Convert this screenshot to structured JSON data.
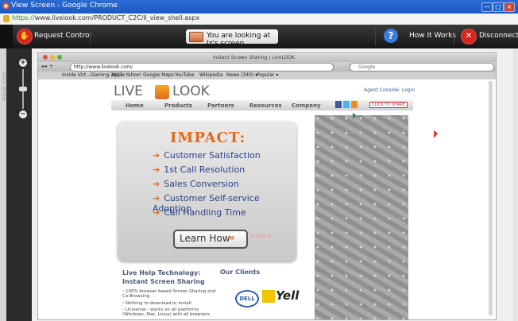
{
  "window": {
    "title": "View Screen - Google Chrome",
    "url_scheme": "https://",
    "url_rest": "www.livelook.com/PRODUCT_C2C/ll_view_shell.aspx",
    "min_label": "—",
    "max_label": "□",
    "close_label": "×"
  },
  "toolbar": {
    "request_control_label": "Request Control",
    "notice_text": "You are looking at Iz's screen",
    "how_it_works_label": "How It Works",
    "disconnect_label": "Disconnect",
    "request_icon_glyph": "✋",
    "help_icon_glyph": "?",
    "disconnect_icon_glyph": "✕"
  },
  "zoom_panel": {
    "label": "Adjust zoom",
    "plus": "+",
    "minus": "−"
  },
  "mac_window": {
    "title": "Instant Screen Sharing | LiveLOOK",
    "address": "http://www.livelook.com/",
    "search_placeholder": "Google",
    "bookmarks": [
      "Inside Virt...Gaming 2011",
      "Apple",
      "Yahoo!",
      "Google Maps",
      "YouTube",
      "Wikipedia",
      "News (340) ▾",
      "Popular ▾"
    ]
  },
  "site": {
    "logo_left": "LIVE",
    "logo_right": "LOOK",
    "top_links": [
      "Agent Console",
      "Login"
    ],
    "nav": [
      "Home",
      "Products",
      "Partners",
      "Resources",
      "Company"
    ],
    "click_to_share": "CLICK TO SHARE",
    "impact_title": "IMPACT:",
    "impact_items": [
      "Customer Satisfaction",
      "1st Call Resolution",
      "Sales Conversion",
      "Customer Self-service Adoption",
      "Call Handling Time"
    ],
    "learn_how": "Learn How",
    "footer_col1_title": "Live Help Technology:\nInstant Screen Sharing",
    "footer_col1_bullets": [
      "100% browser based Screen Sharing and Co-Browsing",
      "Nothing to download or install",
      "Universal - works on all platforms (Windows, Mac, Linux) with all browsers"
    ],
    "footer_col2_title": "Our Clients",
    "client_logos": [
      "DELL",
      "Yell"
    ]
  },
  "colors": {
    "accent_orange": "#e06a1e",
    "impact_blue": "#2a3f8a",
    "chrome_blue": "#1a58c4",
    "disconnect_red": "#d7261e"
  }
}
